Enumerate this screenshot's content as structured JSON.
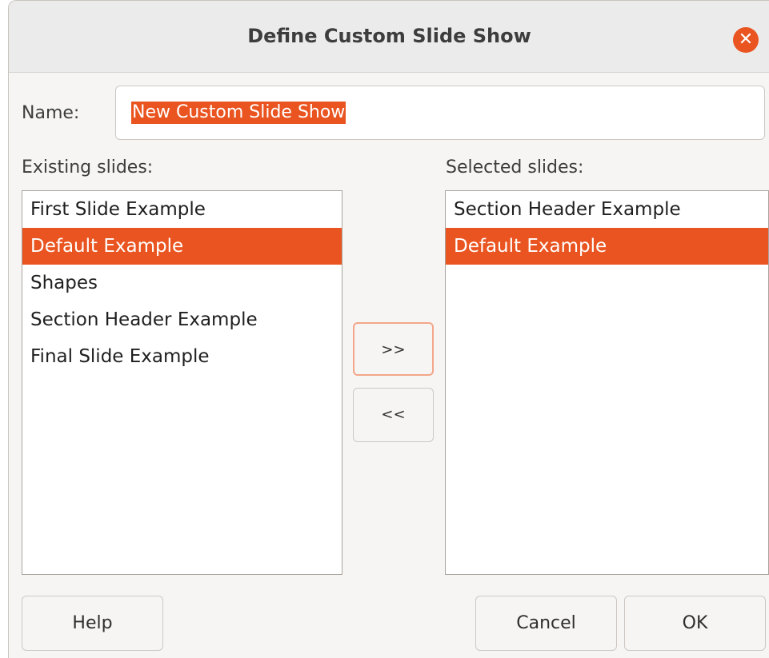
{
  "dialog": {
    "title": "Define Custom Slide Show",
    "close_icon": "close-icon"
  },
  "name": {
    "label": "Name:",
    "value": "New Custom Slide Show"
  },
  "existing": {
    "label": "Existing slides:",
    "items": [
      {
        "label": "First Slide Example",
        "selected": false
      },
      {
        "label": "Default Example",
        "selected": true
      },
      {
        "label": "Shapes",
        "selected": false
      },
      {
        "label": "Section Header Example",
        "selected": false
      },
      {
        "label": "Final Slide Example",
        "selected": false
      }
    ]
  },
  "selected": {
    "label": "Selected slides:",
    "items": [
      {
        "label": "Section Header Example",
        "selected": false
      },
      {
        "label": "Default Example",
        "selected": true
      }
    ]
  },
  "buttons": {
    "add": ">>",
    "remove": "<<",
    "help": "Help",
    "cancel": "Cancel",
    "ok": "OK"
  },
  "colors": {
    "accent": "#e95420"
  }
}
